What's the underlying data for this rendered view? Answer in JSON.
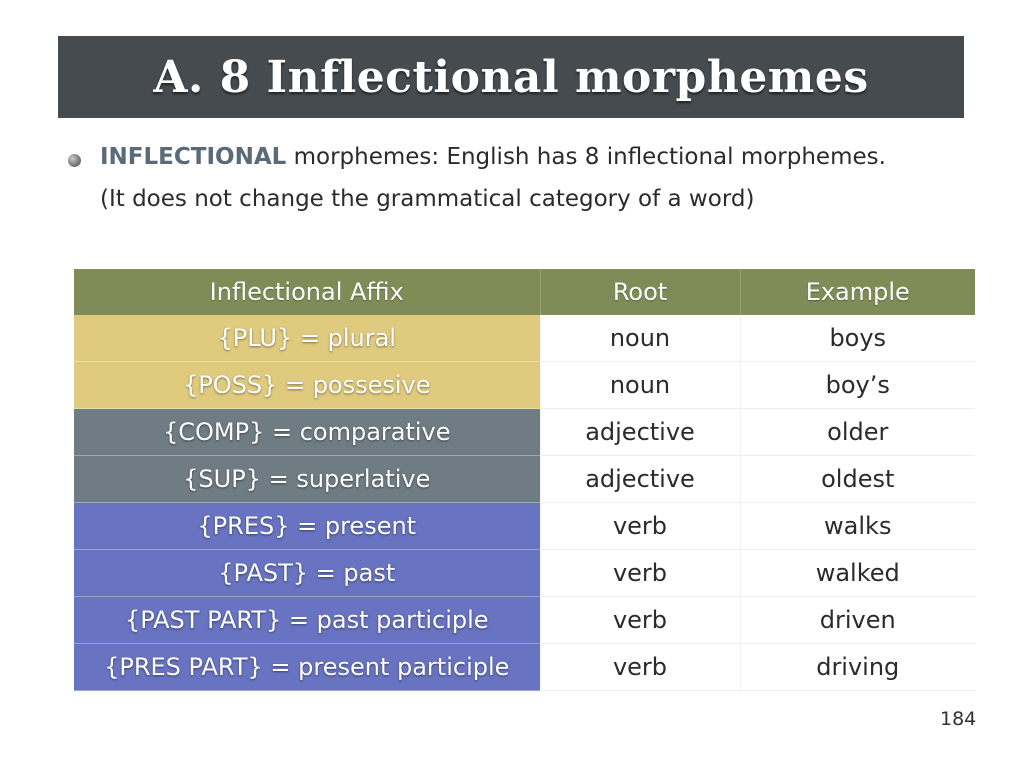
{
  "slide": {
    "title": "A. 8 Inflectional morphemes",
    "page_number": "184"
  },
  "bullet": {
    "keyword": "INFLECTIONAL",
    "line1_rest": " morphemes: English has 8 inflectional morphemes.",
    "line2": "(It does not change the grammatical category of a word)"
  },
  "table": {
    "headers": [
      "Inflectional Affix",
      "Root",
      "Example"
    ],
    "rows": [
      {
        "affix": "{PLU} = plural",
        "root": "noun",
        "example": "boys"
      },
      {
        "affix": "{POSS} = possesive",
        "root": "noun",
        "example": "boy’s"
      },
      {
        "affix": "{COMP} = comparative",
        "root": "adjective",
        "example": "older"
      },
      {
        "affix": "{SUP} = superlative",
        "root": "adjective",
        "example": "oldest"
      },
      {
        "affix": "{PRES} = present",
        "root": "verb",
        "example": "walks"
      },
      {
        "affix": "{PAST} = past",
        "root": "verb",
        "example": "walked"
      },
      {
        "affix": "{PAST PART} = past participle",
        "root": "verb",
        "example": "driven"
      },
      {
        "affix": "{PRES PART} = present participle",
        "root": "verb",
        "example": "driving"
      }
    ]
  },
  "colors": {
    "title_bar": "#464b50",
    "header_row": "#7f8c57",
    "noun_affix": "#dfca7e",
    "adjective_affix": "#6f7c84",
    "verb_affix": "#6873c1",
    "keyword": "#5a6a78"
  },
  "icons": {
    "bullet": "bullet-dot-icon"
  }
}
